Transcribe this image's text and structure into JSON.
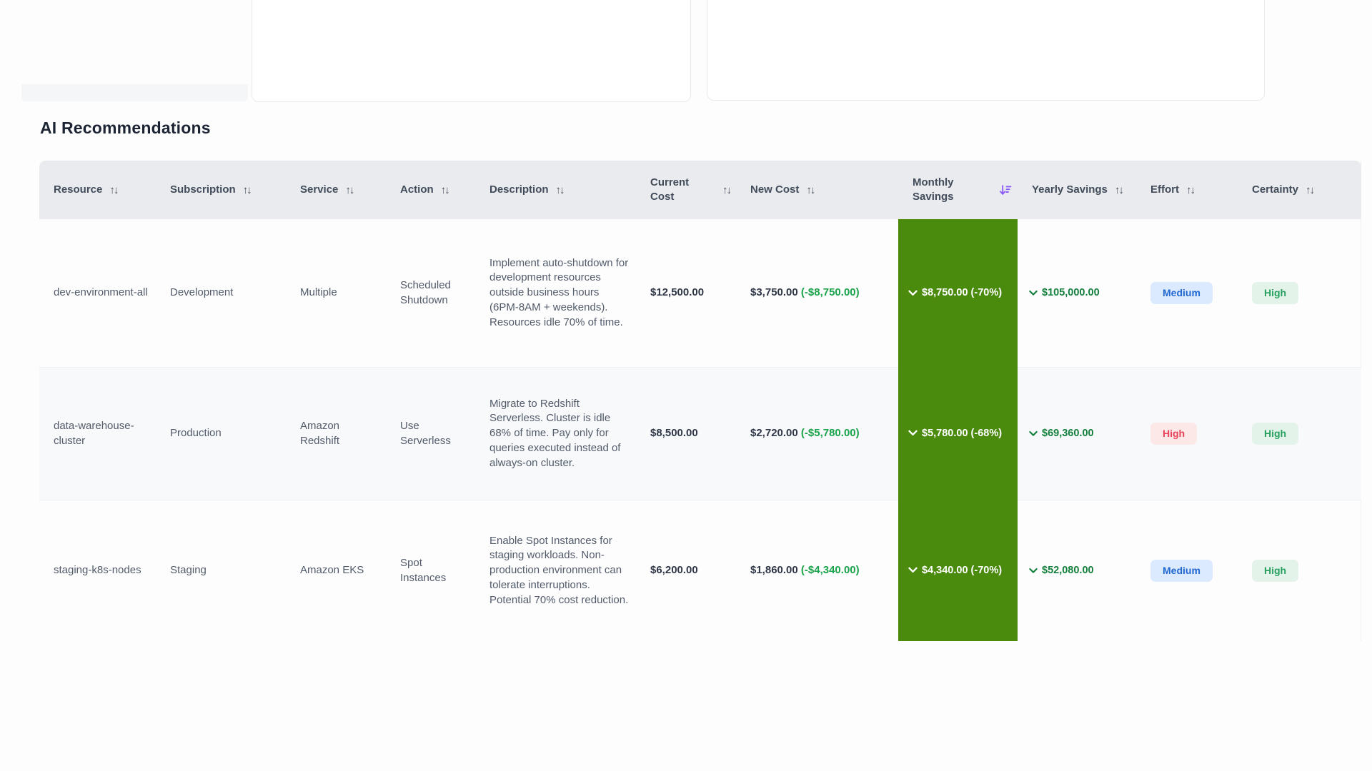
{
  "page": {
    "title": "AI Recommendations"
  },
  "icons": {
    "sort_inactive": "↑↓"
  },
  "colors": {
    "header_bg": "#e9ebee",
    "monthly_savings_column_bg": "#4a8b0d",
    "savings_green_text": "#15803d",
    "delta_green_text": "#1aa34a",
    "active_sort_purple": "#8b5cf6",
    "effort_medium_bg": "#dbeafe",
    "effort_medium_text": "#2268d1",
    "effort_high_bg": "#fde8e8",
    "effort_high_text": "#e8435c",
    "certainty_high_bg": "#e4f3e9",
    "certainty_high_text": "#27a05f"
  },
  "table": {
    "columns": [
      {
        "label": "Resource",
        "sorted": "none"
      },
      {
        "label": "Subscription",
        "sorted": "none"
      },
      {
        "label": "Service",
        "sorted": "none"
      },
      {
        "label": "Action",
        "sorted": "none"
      },
      {
        "label": "Description",
        "sorted": "none"
      },
      {
        "label": "Current Cost",
        "sorted": "none"
      },
      {
        "label": "New Cost",
        "sorted": "none"
      },
      {
        "label": "Monthly Savings",
        "sorted": "desc"
      },
      {
        "label": "Yearly Savings",
        "sorted": "none"
      },
      {
        "label": "Effort",
        "sorted": "none"
      },
      {
        "label": "Certainty",
        "sorted": "none"
      }
    ],
    "rows": [
      {
        "resource": "dev-environment-all",
        "subscription": "Development",
        "service": "Multiple",
        "action": "Scheduled Shutdown",
        "description": "Implement auto-shutdown for development resources outside business hours (6PM-8AM + weekends). Resources idle 70% of time.",
        "current_cost": "$12,500.00",
        "new_cost": "$3,750.00",
        "new_cost_delta": "(-$8,750.00)",
        "monthly_savings": "$8,750.00 (-70%)",
        "yearly_savings": "$105,000.00",
        "effort": "Medium",
        "certainty": "High"
      },
      {
        "resource": "data-warehouse-cluster",
        "subscription": "Production",
        "service": "Amazon Redshift",
        "action": "Use Serverless",
        "description": "Migrate to Redshift Serverless. Cluster is idle 68% of time. Pay only for queries executed instead of always-on cluster.",
        "current_cost": "$8,500.00",
        "new_cost": "$2,720.00",
        "new_cost_delta": "(-$5,780.00)",
        "monthly_savings": "$5,780.00 (-68%)",
        "yearly_savings": "$69,360.00",
        "effort": "High",
        "certainty": "High"
      },
      {
        "resource": "staging-k8s-nodes",
        "subscription": "Staging",
        "service": "Amazon EKS",
        "action": "Spot Instances",
        "description": "Enable Spot Instances for staging workloads. Non-production environment can tolerate interruptions. Potential 70% cost reduction.",
        "current_cost": "$6,200.00",
        "new_cost": "$1,860.00",
        "new_cost_delta": "(-$4,340.00)",
        "monthly_savings": "$4,340.00 (-70%)",
        "yearly_savings": "$52,080.00",
        "effort": "Medium",
        "certainty": "High"
      }
    ]
  }
}
